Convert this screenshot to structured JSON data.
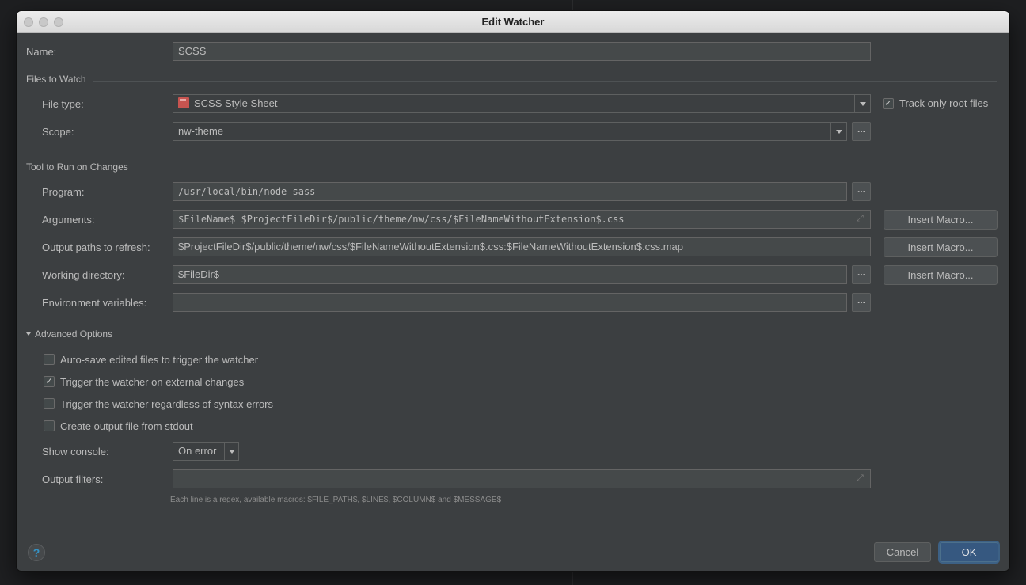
{
  "window": {
    "title": "Edit Watcher"
  },
  "name": {
    "label": "Name:",
    "value": "SCSS"
  },
  "files_to_watch": {
    "section": "Files to Watch",
    "file_type_label": "File type:",
    "file_type_value": "SCSS Style Sheet",
    "file_type_icon": "scss-file-icon",
    "track_only_root_label": "Track only root files",
    "track_only_root_checked": true,
    "scope_label": "Scope:",
    "scope_value": "nw-theme"
  },
  "tool": {
    "section": "Tool to Run on Changes",
    "program_label": "Program:",
    "program_value": "/usr/local/bin/node-sass",
    "arguments_label": "Arguments:",
    "arguments_value": "$FileName$ $ProjectFileDir$/public/theme/nw/css/$FileNameWithoutExtension$.css",
    "output_paths_label": "Output paths to refresh:",
    "output_paths_value": "$ProjectFileDir$/public/theme/nw/css/$FileNameWithoutExtension$.css:$FileNameWithoutExtension$.css.map",
    "working_dir_label": "Working directory:",
    "working_dir_value": "$FileDir$",
    "env_vars_label": "Environment variables:",
    "env_vars_value": "",
    "insert_macro_label": "Insert Macro...",
    "browse_label": "..."
  },
  "advanced": {
    "section": "Advanced Options",
    "options": [
      {
        "label": "Auto-save edited files to trigger the watcher",
        "checked": false
      },
      {
        "label": "Trigger the watcher on external changes",
        "checked": true
      },
      {
        "label": "Trigger the watcher regardless of syntax errors",
        "checked": false
      },
      {
        "label": "Create output file from stdout",
        "checked": false
      }
    ],
    "show_console_label": "Show console:",
    "show_console_value": "On error",
    "output_filters_label": "Output filters:",
    "output_filters_value": "",
    "output_filters_hint": "Each line is a regex, available macros: $FILE_PATH$, $LINE$, $COLUMN$ and $MESSAGE$"
  },
  "footer": {
    "help_label": "?",
    "cancel_label": "Cancel",
    "ok_label": "OK"
  },
  "colors": {
    "background": "#3c3f41",
    "field": "#45494a",
    "accent": "#365880",
    "text": "#bbbbbb"
  }
}
